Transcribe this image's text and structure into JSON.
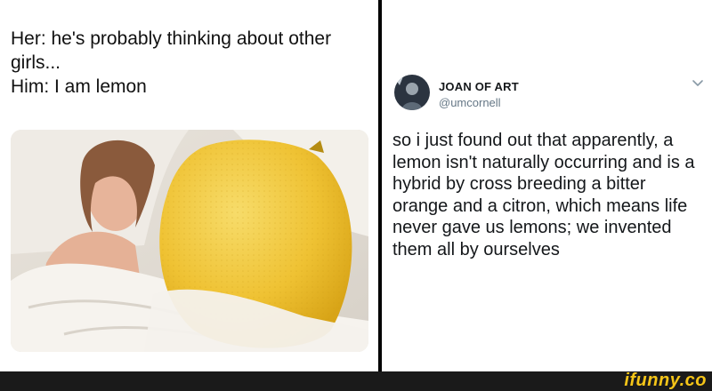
{
  "meme": {
    "caption_lines": [
      "Her: he's probably thinking about other",
      "girls...",
      "Him: I am lemon"
    ]
  },
  "tweet": {
    "display_name": "JOAN OF ART",
    "handle": "@umcornell",
    "text": "so i just found out that apparently, a lemon isn't naturally occurring and is a hybrid by cross breeding a bitter orange and a citron, which means life never gave us lemons; we invented them all by ourselves",
    "menu_icon": "chevron-down-icon"
  },
  "footer": {
    "watermark": "ifunny.co"
  },
  "colors": {
    "divider": "#000000",
    "footer_bg": "#1a1a1a",
    "watermark": "#f5c518",
    "lemon": "#f1c232",
    "handle_gray": "#657786"
  }
}
